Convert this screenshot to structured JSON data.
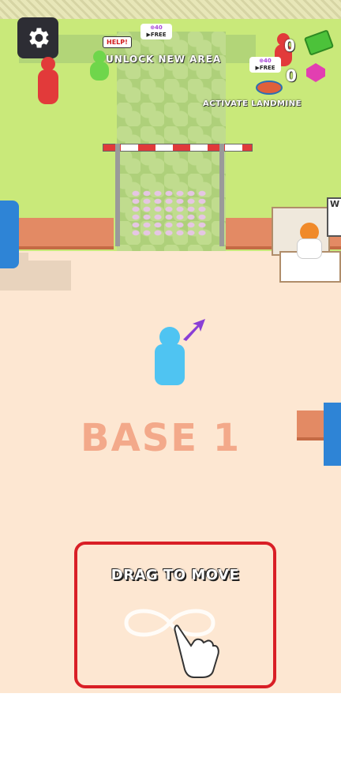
{
  "hud": {
    "unlock_badge": {
      "price": "⊕40",
      "label": "▶FREE"
    },
    "unlock_area_label": "UNLOCK NEW AREA",
    "help_label": "HELP!",
    "cash_count": "0",
    "gem_badge": {
      "price": "⊕40",
      "label": "▶FREE"
    },
    "gem_count": "0",
    "landmine_label": "ACTIVATE LANDMINE"
  },
  "shop": {
    "sign_text": "W S"
  },
  "world": {
    "base_label": "BASE 1"
  },
  "tutorial": {
    "instruction": "DRAG TO MOVE"
  },
  "icons": [
    "gear-icon",
    "cash-icon",
    "gem-icon",
    "landmine-icon",
    "direction-arrow-icon",
    "infinity-gesture-icon",
    "pointing-hand-icon"
  ],
  "colors": {
    "player": "#4fc4f2",
    "arrow": "#8a3fd6",
    "enemy_red": "#e23a3a",
    "enemy_green": "#6fd64b",
    "tutorial_border": "#d91f26",
    "grass": "#c9e97a",
    "floor": "#fde7d2"
  }
}
